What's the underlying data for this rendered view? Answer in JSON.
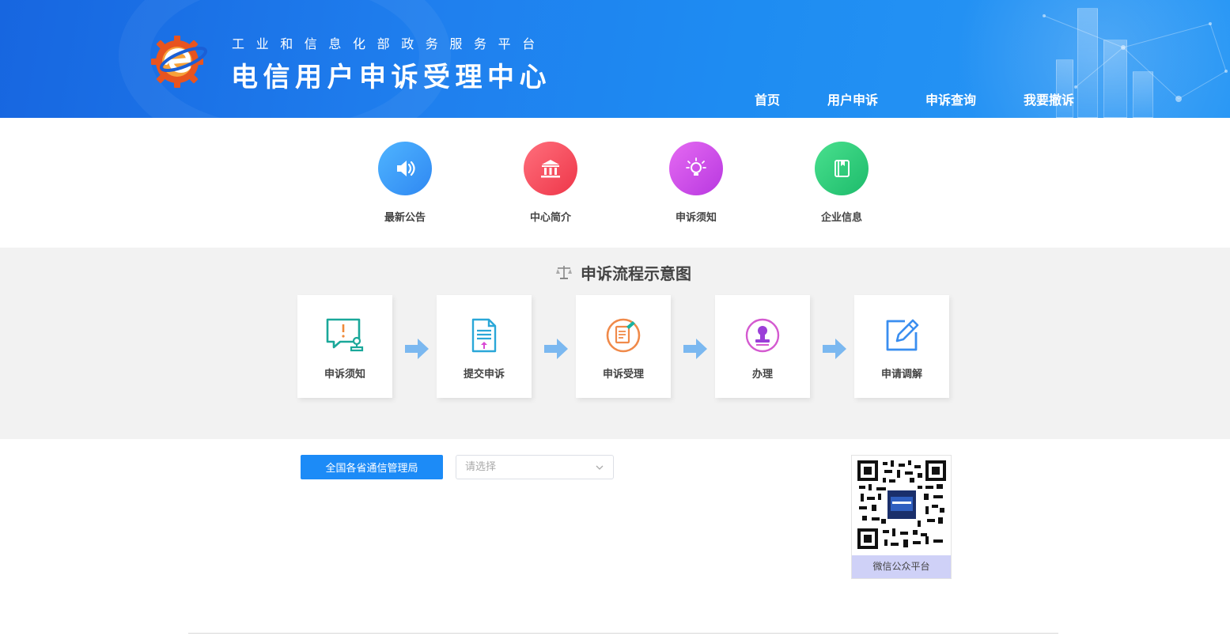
{
  "header": {
    "subtitle": "工业和信息化部政务服务平台",
    "title": "电信用户申诉受理中心",
    "nav": [
      {
        "label": "首页"
      },
      {
        "label": "用户申诉"
      },
      {
        "label": "申诉查询"
      },
      {
        "label": "我要撤诉"
      }
    ]
  },
  "quick_links": [
    {
      "label": "最新公告",
      "icon": "speaker-icon",
      "color": "#3d9ef8"
    },
    {
      "label": "中心简介",
      "icon": "building-icon",
      "color": "#f24a5a"
    },
    {
      "label": "申诉须知",
      "icon": "lightbulb-icon",
      "color": "#cc4fe8"
    },
    {
      "label": "企业信息",
      "icon": "book-icon",
      "color": "#2fcc7a"
    }
  ],
  "flow": {
    "title": "申诉流程示意图",
    "title_icon": "scale-icon",
    "steps": [
      {
        "label": "申诉须知",
        "icon": "notice-chat-icon"
      },
      {
        "label": "提交申诉",
        "icon": "upload-document-icon"
      },
      {
        "label": "申诉受理",
        "icon": "accept-clipboard-icon"
      },
      {
        "label": "办理",
        "icon": "stamp-icon"
      },
      {
        "label": "申请调解",
        "icon": "edit-icon"
      }
    ]
  },
  "bureau": {
    "button_label": "全国各省通信管理局",
    "select_placeholder": "请选择"
  },
  "qr": {
    "label": "微信公众平台"
  },
  "colors": {
    "header_blue": "#1f7fee",
    "primary_button": "#1c8bf7",
    "flow_background": "#f2f2f2"
  }
}
